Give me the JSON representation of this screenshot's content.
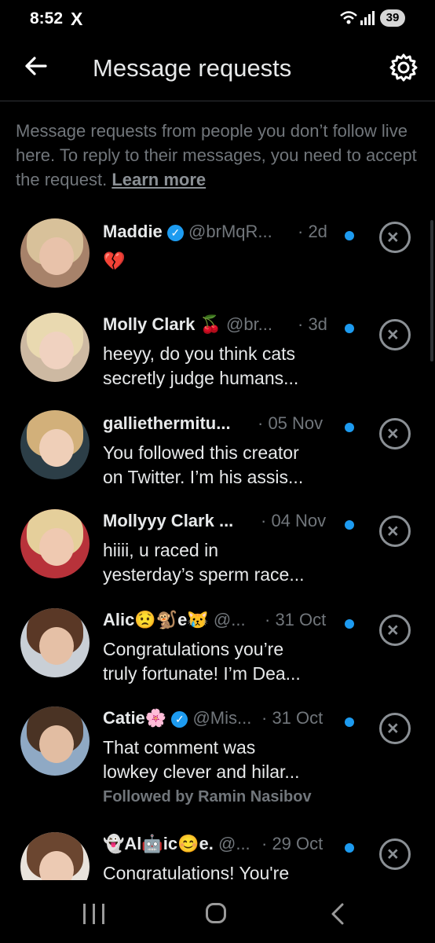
{
  "status_bar": {
    "time": "8:52",
    "app_icon": "X",
    "battery": "39"
  },
  "header": {
    "title": "Message requests",
    "back_icon": "arrow-left-icon",
    "settings_icon": "gear-icon"
  },
  "description": {
    "text": "Message requests from people you don’t follow live here. To reply to their messages, you need to accept the request.",
    "link": "Learn more"
  },
  "colors": {
    "accent": "#1d9bf0",
    "background": "#000000",
    "muted": "#71767b",
    "text": "#e7e9ea"
  },
  "requests": [
    {
      "name": "Maddie",
      "verified": true,
      "handle": "@brMqR...",
      "date": "· 2d",
      "unread": true,
      "lines": [
        "💔"
      ],
      "followed_by": ""
    },
    {
      "name": "Molly Clark 🍒",
      "verified": false,
      "handle": "@br...",
      "date": "· 3d",
      "unread": true,
      "lines": [
        "heeyy, do you think cats",
        "secretly judge humans..."
      ],
      "followed_by": ""
    },
    {
      "name": "galliethermitu...",
      "verified": false,
      "handle": "",
      "date": "· 05 Nov",
      "unread": true,
      "lines": [
        "You followed this creator",
        "on Twitter. I’m his assis..."
      ],
      "followed_by": ""
    },
    {
      "name": "Mollyyy Clark ...",
      "verified": false,
      "handle": "",
      "date": "· 04 Nov",
      "unread": true,
      "lines": [
        "hiiii, u raced in",
        "yesterday’s sperm race..."
      ],
      "followed_by": ""
    },
    {
      "name": "Alic😟🐒e😿",
      "verified": false,
      "handle": "@...",
      "date": "· 31 Oct",
      "unread": true,
      "lines": [
        "Congratulations you’re",
        "truly fortunate! I’m Dea..."
      ],
      "followed_by": ""
    },
    {
      "name": "Catie🌸",
      "verified": true,
      "handle": "@Mis...",
      "date": "· 31 Oct",
      "unread": true,
      "lines": [
        "That comment was",
        "lowkey clever and hilar..."
      ],
      "followed_by": "Followed by Ramin Nasibov"
    },
    {
      "name": "👻Al🤖ic😊e.",
      "verified": false,
      "handle": "@...",
      "date": "· 29 Oct",
      "unread": true,
      "lines": [
        "Congratulations! You're"
      ],
      "followed_by": ""
    }
  ]
}
